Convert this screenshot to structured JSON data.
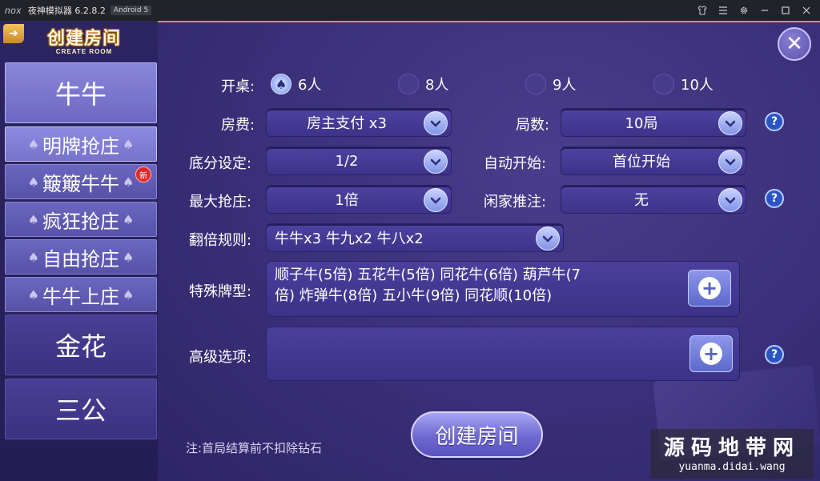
{
  "titlebar": {
    "logo": "nox",
    "title": "夜神模拟器 6.2.8.2",
    "android_badge": "Android 5"
  },
  "header": {
    "logo_cn": "创建房间",
    "logo_en": "CREATE ROOM"
  },
  "sidebar": {
    "games": [
      {
        "label": "牛牛"
      },
      {
        "label": "金花"
      },
      {
        "label": "三公"
      }
    ],
    "modes": [
      {
        "label": "明牌抢庄"
      },
      {
        "label": "簸簸牛牛",
        "badge": "新"
      },
      {
        "label": "疯狂抢庄"
      },
      {
        "label": "自由抢庄"
      },
      {
        "label": "牛牛上庄"
      }
    ]
  },
  "form": {
    "table_label": "开桌:",
    "table_options": [
      "6人",
      "8人",
      "9人",
      "10人"
    ],
    "table_selected": "6人",
    "room_fee_label": "房费:",
    "room_fee_value": "房主支付 x3",
    "rounds_label": "局数:",
    "rounds_value": "10局",
    "base_score_label": "底分设定:",
    "base_score_value": "1/2",
    "auto_start_label": "自动开始:",
    "auto_start_value": "首位开始",
    "max_banker_label": "最大抢庄:",
    "max_banker_value": "1倍",
    "player_push_label": "闲家推注:",
    "player_push_value": "无",
    "double_rules_label": "翻倍规则:",
    "double_rules_value": "牛牛x3  牛九x2  牛八x2",
    "special_label": "特殊牌型:",
    "special_value_line1": "顺子牛(5倍)  五花牛(5倍)  同花牛(6倍)  葫芦牛(7",
    "special_value_line2": "倍)  炸弹牛(8倍)  五小牛(9倍)  同花顺(10倍)",
    "advanced_label": "高级选项:",
    "advanced_value": ""
  },
  "actions": {
    "create_label": "创建房间",
    "close_glyph": "✕",
    "plus_glyph": "+",
    "help_glyph": "?"
  },
  "note": "注:首局结算前不扣除钻石",
  "watermark": {
    "cn": "源码地带网",
    "en": "yuanma.didai.wang"
  },
  "colors": {
    "panel": "#3a2f78",
    "accent": "#6f68d0",
    "gold": "#c99a4a"
  }
}
